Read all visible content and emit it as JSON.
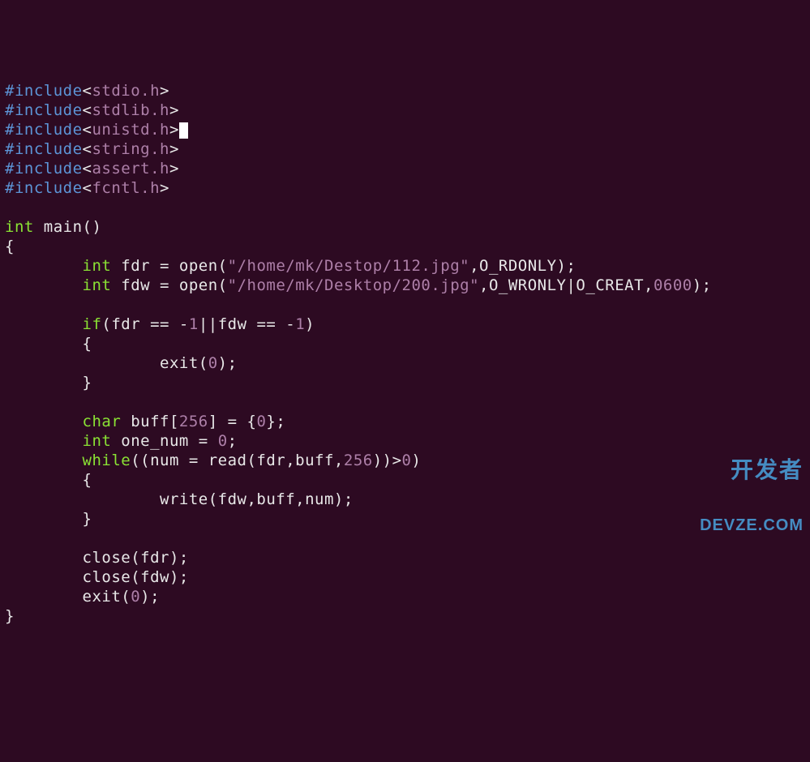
{
  "code": {
    "lines": [
      {
        "segments": [
          {
            "cls": "pp",
            "text": "#include"
          },
          {
            "cls": "ident",
            "text": "<"
          },
          {
            "cls": "hdr",
            "text": "stdio.h"
          },
          {
            "cls": "ident",
            "text": ">"
          }
        ]
      },
      {
        "segments": [
          {
            "cls": "pp",
            "text": "#include"
          },
          {
            "cls": "ident",
            "text": "<"
          },
          {
            "cls": "hdr",
            "text": "stdlib.h"
          },
          {
            "cls": "ident",
            "text": ">"
          }
        ]
      },
      {
        "segments": [
          {
            "cls": "pp",
            "text": "#include"
          },
          {
            "cls": "ident",
            "text": "<"
          },
          {
            "cls": "hdr",
            "text": "unistd.h"
          },
          {
            "cls": "ident",
            "text": ">"
          },
          {
            "cursor": true
          }
        ]
      },
      {
        "segments": [
          {
            "cls": "pp",
            "text": "#include"
          },
          {
            "cls": "ident",
            "text": "<"
          },
          {
            "cls": "hdr",
            "text": "string.h"
          },
          {
            "cls": "ident",
            "text": ">"
          }
        ]
      },
      {
        "segments": [
          {
            "cls": "pp",
            "text": "#include"
          },
          {
            "cls": "ident",
            "text": "<"
          },
          {
            "cls": "hdr",
            "text": "assert.h"
          },
          {
            "cls": "ident",
            "text": ">"
          }
        ]
      },
      {
        "segments": [
          {
            "cls": "pp",
            "text": "#include"
          },
          {
            "cls": "ident",
            "text": "<"
          },
          {
            "cls": "hdr",
            "text": "fcntl.h"
          },
          {
            "cls": "ident",
            "text": ">"
          }
        ]
      },
      {
        "segments": [
          {
            "cls": "ident",
            "text": ""
          }
        ]
      },
      {
        "segments": [
          {
            "cls": "kw",
            "text": "int"
          },
          {
            "cls": "ident",
            "text": " main()"
          }
        ]
      },
      {
        "segments": [
          {
            "cls": "ident",
            "text": "{"
          }
        ]
      },
      {
        "segments": [
          {
            "cls": "ident",
            "text": "        "
          },
          {
            "cls": "kw",
            "text": "int"
          },
          {
            "cls": "ident",
            "text": " fdr = open("
          },
          {
            "cls": "str",
            "text": "\"/home/mk/Destop/112.jpg\""
          },
          {
            "cls": "ident",
            "text": ",O_RDONLY);"
          }
        ]
      },
      {
        "segments": [
          {
            "cls": "ident",
            "text": "        "
          },
          {
            "cls": "kw",
            "text": "int"
          },
          {
            "cls": "ident",
            "text": " fdw = open("
          },
          {
            "cls": "str",
            "text": "\"/home/mk/Desktop/200.jpg\""
          },
          {
            "cls": "ident",
            "text": ",O_WRONLY|O_CREAT,"
          },
          {
            "cls": "num",
            "text": "0600"
          },
          {
            "cls": "ident",
            "text": ");"
          }
        ]
      },
      {
        "segments": [
          {
            "cls": "ident",
            "text": ""
          }
        ]
      },
      {
        "segments": [
          {
            "cls": "ident",
            "text": "        "
          },
          {
            "cls": "kw",
            "text": "if"
          },
          {
            "cls": "ident",
            "text": "(fdr == -"
          },
          {
            "cls": "num",
            "text": "1"
          },
          {
            "cls": "ident",
            "text": "||fdw == -"
          },
          {
            "cls": "num",
            "text": "1"
          },
          {
            "cls": "ident",
            "text": ")"
          }
        ]
      },
      {
        "segments": [
          {
            "cls": "ident",
            "text": "        {"
          }
        ]
      },
      {
        "segments": [
          {
            "cls": "ident",
            "text": "                exit("
          },
          {
            "cls": "num",
            "text": "0"
          },
          {
            "cls": "ident",
            "text": ");"
          }
        ]
      },
      {
        "segments": [
          {
            "cls": "ident",
            "text": "        }"
          }
        ]
      },
      {
        "segments": [
          {
            "cls": "ident",
            "text": ""
          }
        ]
      },
      {
        "segments": [
          {
            "cls": "ident",
            "text": "        "
          },
          {
            "cls": "kw",
            "text": "char"
          },
          {
            "cls": "ident",
            "text": " buff["
          },
          {
            "cls": "num",
            "text": "256"
          },
          {
            "cls": "ident",
            "text": "] = {"
          },
          {
            "cls": "num",
            "text": "0"
          },
          {
            "cls": "ident",
            "text": "};"
          }
        ]
      },
      {
        "segments": [
          {
            "cls": "ident",
            "text": "        "
          },
          {
            "cls": "kw",
            "text": "int"
          },
          {
            "cls": "ident",
            "text": " one_num = "
          },
          {
            "cls": "num",
            "text": "0"
          },
          {
            "cls": "ident",
            "text": ";"
          }
        ]
      },
      {
        "segments": [
          {
            "cls": "ident",
            "text": "        "
          },
          {
            "cls": "kw",
            "text": "while"
          },
          {
            "cls": "ident",
            "text": "((num = read(fdr,buff,"
          },
          {
            "cls": "num",
            "text": "256"
          },
          {
            "cls": "ident",
            "text": "))>"
          },
          {
            "cls": "num",
            "text": "0"
          },
          {
            "cls": "ident",
            "text": ")"
          }
        ]
      },
      {
        "segments": [
          {
            "cls": "ident",
            "text": "        {"
          }
        ]
      },
      {
        "segments": [
          {
            "cls": "ident",
            "text": "                write(fdw,buff,num);"
          }
        ]
      },
      {
        "segments": [
          {
            "cls": "ident",
            "text": "        }"
          }
        ]
      },
      {
        "segments": [
          {
            "cls": "ident",
            "text": ""
          }
        ]
      },
      {
        "segments": [
          {
            "cls": "ident",
            "text": "        close(fdr);"
          }
        ]
      },
      {
        "segments": [
          {
            "cls": "ident",
            "text": "        close(fdw);"
          }
        ]
      },
      {
        "segments": [
          {
            "cls": "ident",
            "text": "        exit("
          },
          {
            "cls": "num",
            "text": "0"
          },
          {
            "cls": "ident",
            "text": ");"
          }
        ]
      },
      {
        "segments": [
          {
            "cls": "ident",
            "text": "}"
          }
        ]
      }
    ]
  },
  "watermark": {
    "line1": "开发者",
    "line2": "DEVZE.COM"
  }
}
